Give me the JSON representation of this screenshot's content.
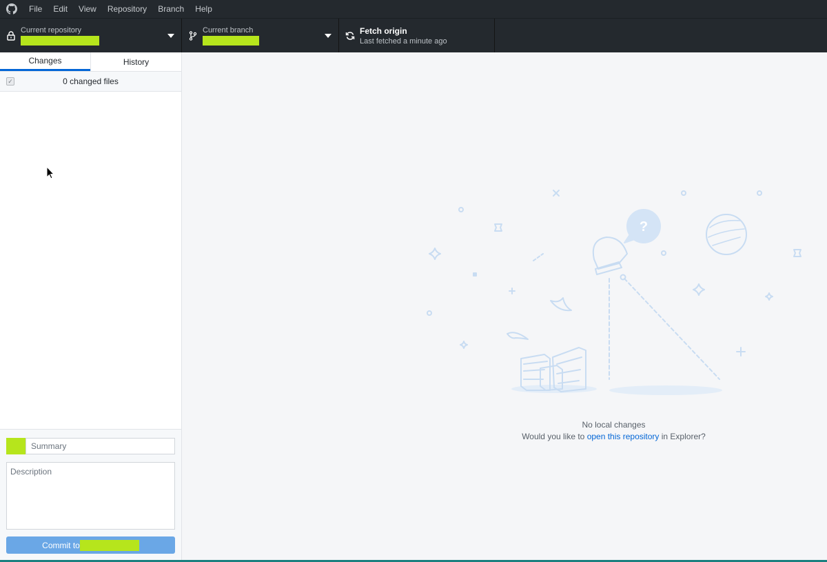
{
  "menubar": {
    "items": [
      "File",
      "Edit",
      "View",
      "Repository",
      "Branch",
      "Help"
    ]
  },
  "toolbar": {
    "repo_label": "Current repository",
    "branch_label": "Current branch",
    "fetch_title": "Fetch origin",
    "fetch_subtitle": "Last fetched a minute ago"
  },
  "sidebar": {
    "tabs": [
      "Changes",
      "History"
    ],
    "changed_files": "0 changed files"
  },
  "commit": {
    "summary_placeholder": "Summary",
    "description_placeholder": "Description",
    "button_label": "Commit to"
  },
  "main": {
    "empty_title": "No local changes",
    "prompt_prefix": "Would you like to ",
    "prompt_link": "open this repository",
    "prompt_suffix": " in Explorer?"
  },
  "colors": {
    "titlebar": "#24292e",
    "accent": "#0366d6",
    "commit_button": "#6aa7e6",
    "redaction": "#b6e51c"
  },
  "icons": [
    "github-logo-icon",
    "lock-icon",
    "branch-icon",
    "sync-icon",
    "caret-down-icon",
    "checkbox-icon",
    "mouse-cursor-icon"
  ]
}
